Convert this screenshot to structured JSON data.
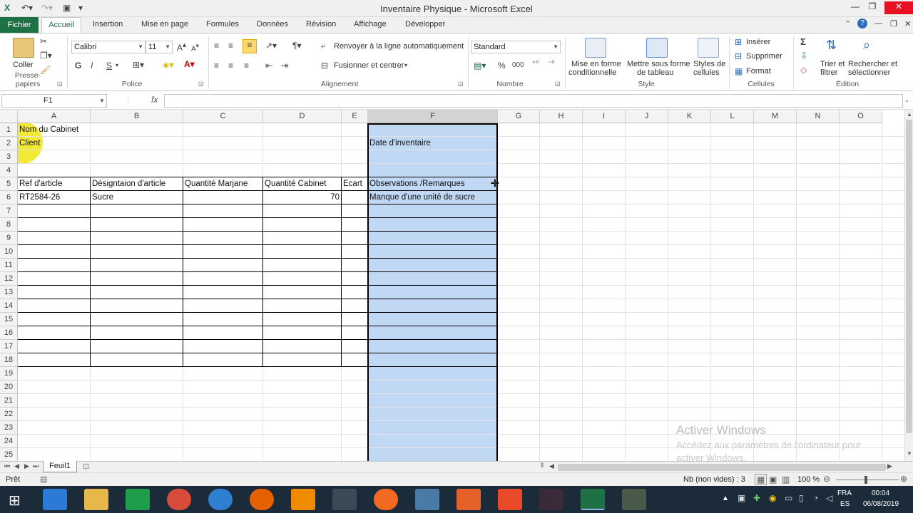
{
  "window": {
    "title": "Inventaire Physique - Microsoft Excel"
  },
  "ribbon_tabs": {
    "file": "Fichier",
    "home": "Accueil",
    "insert": "Insertion",
    "layout": "Mise en page",
    "formulas": "Formules",
    "data": "Données",
    "review": "Révision",
    "view": "Affichage",
    "developer": "Développer"
  },
  "clipboard": {
    "paste": "Coller",
    "group": "Presse-papiers"
  },
  "font": {
    "name": "Calibri",
    "size": "11",
    "bold": "G",
    "italic": "I",
    "underline": "S",
    "group": "Police"
  },
  "alignment": {
    "wrap": "Renvoyer à la ligne automatiquement",
    "merge": "Fusionner et centrer",
    "group": "Alignement"
  },
  "number": {
    "format": "Standard",
    "percent": "%",
    "thousands": "000",
    "group": "Nombre"
  },
  "style": {
    "conditional_1": "Mise en forme",
    "conditional_2": "conditionnelle",
    "table_1": "Mettre sous forme",
    "table_2": "de tableau",
    "cell_styles_1": "Styles de",
    "cell_styles_2": "cellules",
    "group": "Style"
  },
  "cells": {
    "insert": "Insérer",
    "delete": "Supprimer",
    "format": "Format",
    "group": "Cellules"
  },
  "editing": {
    "sum": "Σ",
    "sort_1": "Trier et",
    "sort_2": "filtrer",
    "find_1": "Rechercher et",
    "find_2": "sélectionner",
    "group": "Édition"
  },
  "formula_bar": {
    "name_box": "F1",
    "fx": "fx",
    "value": ""
  },
  "columns": [
    "A",
    "B",
    "C",
    "D",
    "E",
    "F",
    "G",
    "H",
    "I",
    "J",
    "K",
    "L",
    "M",
    "N",
    "O"
  ],
  "rows": [
    "1",
    "2",
    "3",
    "4",
    "5",
    "6",
    "7",
    "8",
    "9",
    "10",
    "11",
    "12",
    "13",
    "14",
    "15",
    "16",
    "17",
    "18",
    "19",
    "20",
    "21",
    "22",
    "23",
    "24",
    "25"
  ],
  "sheet": {
    "a1": "Nom du Cabinet",
    "a2": "Client",
    "f2": "Date d'inventaire",
    "headers": [
      "Ref d'article",
      "Désigntaion d'article",
      "Quantité Marjane",
      "Quantité Cabinet",
      "Ecart",
      "Observations /Remarques"
    ],
    "row6": {
      "ref": "RT2584-26",
      "designation": "Sucre",
      "qty_cabinet": "70",
      "observation": "Manque d'une unité de sucre"
    }
  },
  "sheet_tabs": {
    "active": "Feuil1"
  },
  "status": {
    "ready": "Prêt",
    "count": "Nb (non vides) : 3",
    "zoom": "100 %"
  },
  "watermark": {
    "line1": "Activer Windows",
    "line2": "Accédez aux paramètres de l'ordinateur pour activer Windows."
  },
  "taskbar": {
    "lang1": "FRA",
    "lang2": "ES",
    "time": "00:04",
    "date": "06/08/2019"
  },
  "colors": {
    "excel_green": "#1e7145",
    "selection": "#c0d8f4",
    "taskbar": "#1c2b3a"
  }
}
